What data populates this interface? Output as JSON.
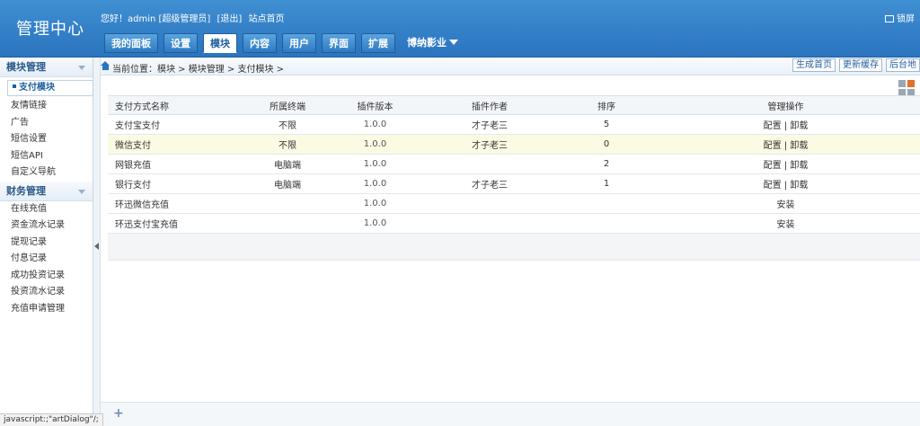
{
  "header": {
    "logo": "管理中心",
    "greeting": "您好！admin [超级管理员]",
    "logout": "[退出]",
    "site_home": "站点首页",
    "lock_screen": "锁屏"
  },
  "nav": {
    "tabs": [
      "我的面板",
      "设置",
      "模块",
      "内容",
      "用户",
      "界面",
      "扩展"
    ],
    "active_tab": "模块",
    "site_menu": "博纳影业"
  },
  "sidebar": {
    "group1": "模块管理",
    "group1_items": [
      "支付模块",
      "友情链接",
      "广告",
      "短信设置",
      "短信API",
      "自定义导航"
    ],
    "group2": "财务管理",
    "group2_items": [
      "在线充值",
      "资金流水记录",
      "提现记录",
      "付息记录",
      "成功投资记录",
      "投资流水记录",
      "充值申请管理"
    ]
  },
  "breadcrumb": {
    "text": "当前位置：模块 > 模块管理 > 支付模块 >",
    "buttons": [
      "生成首页",
      "更新缓存",
      "后台地"
    ]
  },
  "table": {
    "headers": [
      "支付方式名称",
      "所属终端",
      "插件版本",
      "插件作者",
      "排序",
      "管理操作"
    ],
    "rows": [
      {
        "name": "支付宝支付",
        "terminal": "不限",
        "version": "1.0.0",
        "author": "才子老三",
        "order": "5",
        "actions": "配置 | 卸载",
        "highlight": false
      },
      {
        "name": "微信支付",
        "terminal": "不限",
        "version": "1.0.0",
        "author": "才子老三",
        "order": "0",
        "actions": "配置 | 卸载",
        "highlight": true
      },
      {
        "name": "网银充值",
        "terminal": "电脑端",
        "version": "1.0.0",
        "author": "",
        "order": "2",
        "actions": "配置 | 卸载",
        "highlight": false
      },
      {
        "name": "银行支付",
        "terminal": "电脑端",
        "version": "1.0.0",
        "author": "才子老三",
        "order": "1",
        "actions": "配置 | 卸载",
        "highlight": false
      },
      {
        "name": "环迅微信充值",
        "terminal": "",
        "version": "1.0.0",
        "author": "",
        "order": "",
        "actions": "安装",
        "highlight": false
      },
      {
        "name": "环迅支付宝充值",
        "terminal": "",
        "version": "1.0.0",
        "author": "",
        "order": "",
        "actions": "安装",
        "highlight": false
      }
    ]
  },
  "footer": {
    "add": "+"
  },
  "status_bar": "javascript:;\"artDialog\"/;"
}
